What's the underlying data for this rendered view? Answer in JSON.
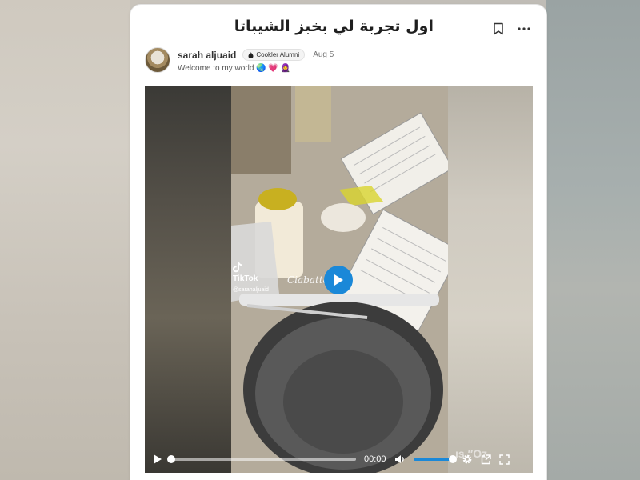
{
  "post": {
    "title": "اول تجربة لي بخبز الشيباتا",
    "author": "sarah aljuaid",
    "badge": "Cookler Alumni",
    "date": "Aug 5",
    "bio": "Welcome to my world 🌏 💗 🧕"
  },
  "video": {
    "platform_label": "TikTok",
    "username": "@sarahaljuaid",
    "overlay_text": "Ciabatta",
    "time": "00:00",
    "progress": 0,
    "volume": 1.0,
    "watermark": "ıs.″Oz"
  },
  "icons": {
    "bookmark": "bookmark-icon",
    "more": "more-options-icon",
    "play": "play-icon",
    "volume": "volume-icon",
    "settings": "gear-icon",
    "external": "external-link-icon",
    "fullscreen": "fullscreen-icon"
  },
  "colors": {
    "accent": "#1a88d8",
    "title": "#1f1f1f"
  }
}
